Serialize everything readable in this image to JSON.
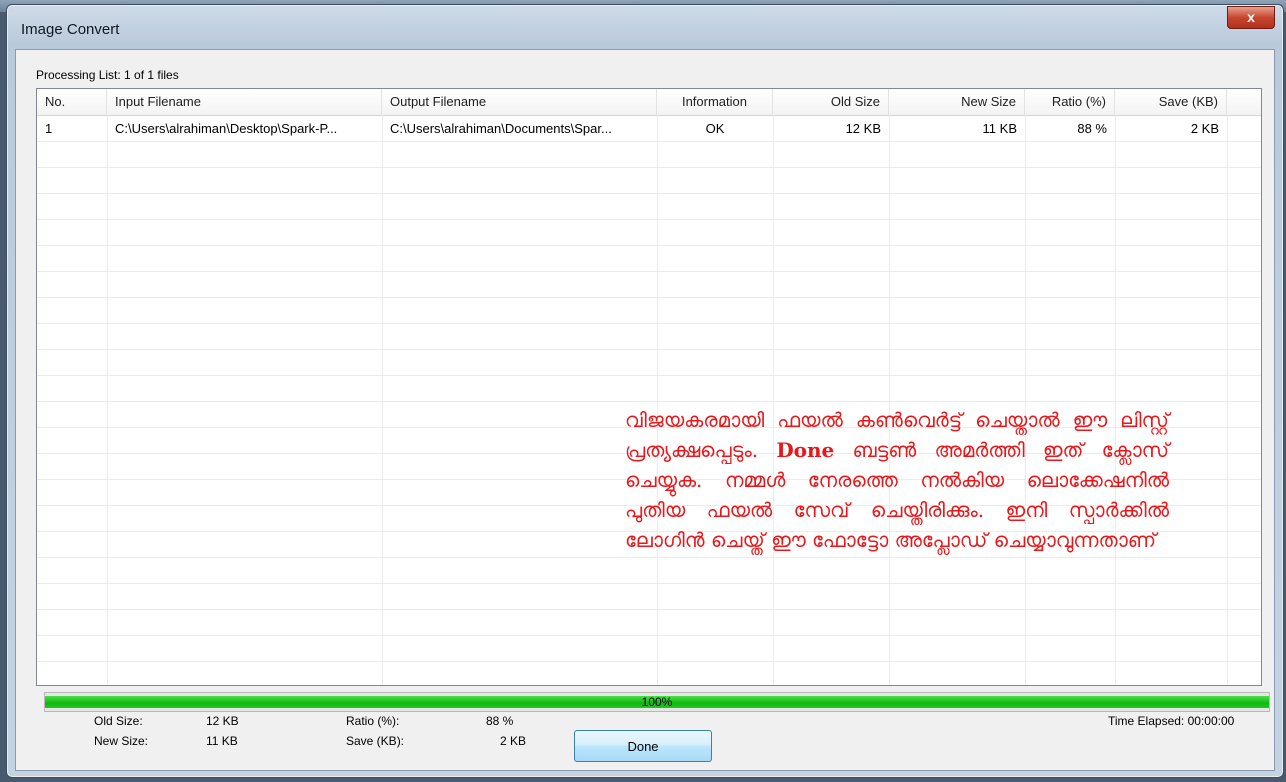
{
  "window": {
    "title": "Image Convert",
    "close_glyph": "x"
  },
  "list": {
    "caption": "Processing List: 1 of 1 files",
    "columns": [
      "No.",
      "Input Filename",
      "Output Filename",
      "Information",
      "Old Size",
      "New Size",
      "Ratio (%)",
      "Save (KB)"
    ],
    "rows": [
      {
        "no": "1",
        "input": "C:\\Users\\alrahiman\\Desktop\\Spark-P...",
        "output": "C:\\Users\\alrahiman\\Documents\\Spar...",
        "info": "OK",
        "old_size": "12 KB",
        "new_size": "11 KB",
        "ratio": "88 %",
        "save": "2 KB"
      }
    ]
  },
  "note": {
    "text_part1": "വിജയകരമായി ഫയൽ കൺവെർട്ട് ചെയ്താൽ ഈ ലിസ്റ്റ് പ്രത്യക്ഷപ്പെടും. ",
    "text_bold": "Done",
    "text_part2": " ബട്ടൺ അമർത്തി ഇത് ക്ലോസ് ചെയ്യുക. നമ്മൾ നേരത്തെ നൽകിയ ലൊക്കേഷനിൽ പുതിയ ഫയൽ സേവ് ചെയ്തിരിക്കും. ഇനി സ്പാർക്കിൽ ലോഗിൻ ചെയ്ത് ഈ ഫോട്ടോ അപ്ലോഡ് ചെയ്യാവുന്നതാണ്"
  },
  "progress": {
    "value": 1.0,
    "label": "100%"
  },
  "stats": {
    "old_size_label": "Old Size:",
    "old_size_value": "12 KB",
    "new_size_label": "New Size:",
    "new_size_value": "11 KB",
    "ratio_label": "Ratio (%):",
    "ratio_value": "88 %",
    "save_label": "Save (KB):",
    "save_value": "2 KB",
    "time_elapsed": "Time Elapsed: 00:00:00"
  },
  "done_button": {
    "label": "Done"
  }
}
